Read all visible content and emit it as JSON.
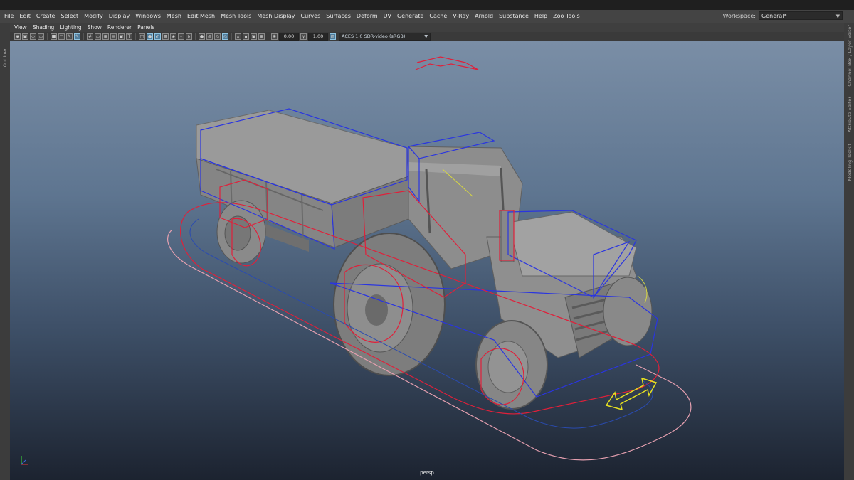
{
  "menubar": {
    "items": [
      "File",
      "Edit",
      "Create",
      "Select",
      "Modify",
      "Display",
      "Windows",
      "Mesh",
      "Edit Mesh",
      "Mesh Tools",
      "Mesh Display",
      "Curves",
      "Surfaces",
      "Deform",
      "UV",
      "Generate",
      "Cache",
      "V-Ray",
      "Arnold",
      "Substance",
      "Help",
      "Zoo Tools"
    ],
    "workspace_label": "Workspace:",
    "workspace_value": "General*"
  },
  "panel_menu": {
    "items": [
      "View",
      "Shading",
      "Lighting",
      "Show",
      "Renderer",
      "Panels"
    ]
  },
  "toolbar": {
    "exposure": "0.00",
    "gamma": "1.00",
    "color_space": "ACES 1.0 SDR-video (sRGB)"
  },
  "side_tabs": {
    "left": "Outliner",
    "right": [
      "Channel Box / Layer Editor",
      "Attribute Editor",
      "Modeling Toolkit"
    ]
  },
  "viewport": {
    "camera_label": "persp"
  },
  "colors": {
    "menubar_bg": "#444444",
    "viewport_top": "#7a8ea6",
    "viewport_bottom": "#1c2330",
    "selection_blue": "#2a35e0",
    "control_red": "#e0203a",
    "move_yellow": "#e6e020"
  }
}
